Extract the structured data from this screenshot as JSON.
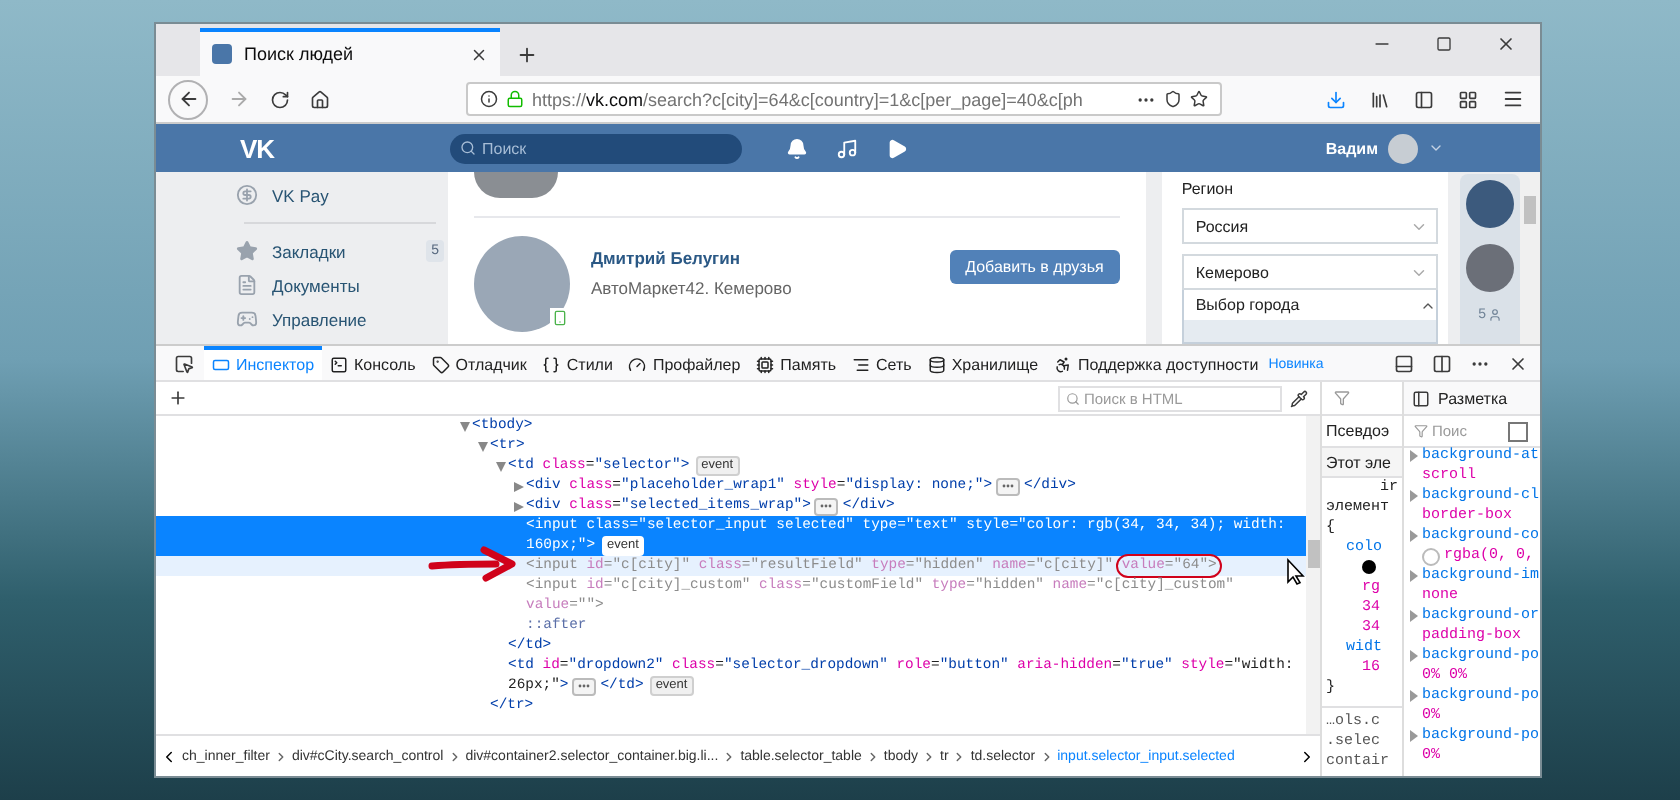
{
  "browser": {
    "tab": {
      "title": "Поиск людей"
    },
    "url": {
      "scheme": "https://",
      "host": "vk.com",
      "rest": "/search?c[city]=64&c[country]=1&c[per_page]=40&c[ph"
    }
  },
  "vk": {
    "logo": "VK",
    "search_placeholder": "Поиск",
    "user_name": "Вадим",
    "sidebar": [
      {
        "label": "VK Pay",
        "kind": "pay"
      },
      {
        "label": "Закладки",
        "kind": "star",
        "count": "5"
      },
      {
        "label": "Документы",
        "kind": "doc"
      },
      {
        "label": "Управление",
        "kind": "game"
      }
    ],
    "person": {
      "name": "Дмитрий Белугин",
      "subtitle": "АвтоМаркет42. Кемерово",
      "action": "Добавить в друзья",
      "online_mobile": true
    },
    "filters": {
      "title": "Регион",
      "country": "Россия",
      "city": "Кемерово",
      "options": [
        "Выбор города"
      ]
    },
    "friends_count": "5"
  },
  "devtools": {
    "tabs": [
      {
        "label": "Инспектор",
        "kind": "inspector",
        "selected": true
      },
      {
        "label": "Консоль",
        "kind": "console",
        "selected": false
      },
      {
        "label": "Отладчик",
        "kind": "debugger",
        "selected": false
      },
      {
        "label": "Стили",
        "kind": "styles",
        "selected": false
      },
      {
        "label": "Профайлер",
        "kind": "profiler",
        "selected": false
      },
      {
        "label": "Память",
        "kind": "memory",
        "selected": false
      },
      {
        "label": "Сеть",
        "kind": "network",
        "selected": false
      },
      {
        "label": "Хранилище",
        "kind": "storage",
        "selected": false
      },
      {
        "label": "Поддержка доступности",
        "kind": "accessibility",
        "selected": false,
        "badge": "Новинка"
      }
    ],
    "search_placeholder": "Поиск в HTML",
    "layout_tab": "Разметка",
    "markup": [
      {
        "parts": [
          {
            "kind": "code",
            "text": "<tbody>"
          }
        ],
        "expanded": true,
        "selected": false,
        "hovered": false,
        "dimmed": false,
        "children": [
          {
            "parts": [
              {
                "kind": "code",
                "text": "<tr>"
              }
            ],
            "expanded": true,
            "selected": false,
            "hovered": false,
            "dimmed": false,
            "children": [
              {
                "parts": [
                  {
                    "kind": "code",
                    "text": "<td class=\"selector\">"
                  },
                  {
                    "kind": "badge",
                    "text": "event"
                  }
                ],
                "expanded": true,
                "selected": false,
                "hovered": false,
                "dimmed": false,
                "children": [
                  {
                    "parts": [
                      {
                        "kind": "code",
                        "text": "<div class=\"placeholder_wrap1\" style=\"display: none;\">"
                      },
                      {
                        "kind": "ellipsis"
                      },
                      {
                        "kind": "code",
                        "text": "</div>"
                      }
                    ],
                    "expanded": false,
                    "selected": false,
                    "hovered": false,
                    "dimmed": false
                  },
                  {
                    "parts": [
                      {
                        "kind": "code",
                        "text": "<div class=\"selected_items_wrap\">"
                      },
                      {
                        "kind": "ellipsis"
                      },
                      {
                        "kind": "code",
                        "text": "</div>"
                      }
                    ],
                    "expanded": false,
                    "selected": false,
                    "hovered": false,
                    "dimmed": false
                  },
                  {
                    "parts": [
                      {
                        "kind": "code",
                        "text": "<input class=\"selector_input selected\" type=\"text\" style=\"color: rgb(34, 34, 34); width:"
                      },
                      {
                        "kind": "code",
                        "text": "160px;\">"
                      },
                      {
                        "kind": "badge",
                        "text": "event"
                      }
                    ],
                    "selected": true,
                    "hovered": false,
                    "dimmed": false
                  },
                  {
                    "parts": [
                      {
                        "kind": "code",
                        "text": "<input id=\"c[city]\" class=\"resultField\" type=\"hidden\" name=\"c[city]\" "
                      },
                      {
                        "kind": "circled",
                        "text": "value=\"64\">"
                      }
                    ],
                    "selected": false,
                    "hovered": true,
                    "dimmed": true
                  },
                  {
                    "parts": [
                      {
                        "kind": "code",
                        "text": "<input id=\"c[city]_custom\" class=\"customField\" type=\"hidden\" name=\"c[city]_custom\""
                      },
                      {
                        "kind": "code",
                        "text": "value=\"\">"
                      }
                    ],
                    "selected": false,
                    "hovered": false,
                    "dimmed": true
                  },
                  {
                    "parts": [
                      {
                        "kind": "code",
                        "text": "::after"
                      }
                    ],
                    "selected": false,
                    "hovered": false,
                    "dimmed": false
                  }
                ]
              },
              {
                "parts": [
                  {
                    "kind": "code",
                    "text": "</td>"
                  }
                ],
                "selected": false,
                "hovered": false,
                "dimmed": false
              },
              {
                "parts": [
                  {
                    "kind": "code",
                    "text": "<td id=\"dropdown2\" class=\"selector_dropdown\" role=\"button\" aria-hidden=\"true\" style=\"width:"
                  },
                  {
                    "kind": "code",
                    "text": "26px;\">"
                  },
                  {
                    "kind": "ellipsis"
                  },
                  {
                    "kind": "code",
                    "text": "</td>"
                  },
                  {
                    "kind": "badge",
                    "text": "event"
                  }
                ],
                "selected": false,
                "hovered": false,
                "dimmed": false
              }
            ]
          },
          {
            "parts": [
              {
                "kind": "code",
                "text": "</tr>"
              }
            ],
            "selected": false,
            "hovered": false,
            "dimmed": false
          }
        ]
      }
    ],
    "breadcrumbs": [
      {
        "text": "ch_inner_filter",
        "selected": false
      },
      {
        "text": "div#cCity.search_control",
        "selected": false
      },
      {
        "text": "div#container2.selector_container.big.li...",
        "selected": false
      },
      {
        "text": "table.selector_table",
        "selected": false
      },
      {
        "text": "tbody",
        "selected": false
      },
      {
        "text": "tr",
        "selected": false
      },
      {
        "text": "td.selector",
        "selected": false
      },
      {
        "text": "input.selector_input.selected",
        "selected": true
      }
    ],
    "rules": {
      "header": "Псевдоэ",
      "section": "Этот эле",
      "lines": [
        {
          "kind": "origin",
          "text": "ir"
        },
        {
          "kind": "selector",
          "text": "элемент"
        },
        {
          "kind": "brace",
          "text": "{"
        },
        {
          "kind": "prop",
          "text": "colo"
        },
        {
          "kind": "swatch"
        },
        {
          "kind": "value",
          "text": "rg"
        },
        {
          "kind": "value",
          "text": "34"
        },
        {
          "kind": "value",
          "text": "34"
        },
        {
          "kind": "prop",
          "text": "widt"
        },
        {
          "kind": "value",
          "text": "16"
        },
        {
          "kind": "brace",
          "text": "}"
        }
      ],
      "sources": [
        "…ols.c",
        ".selec",
        "contair"
      ]
    },
    "computed": {
      "filter_placeholder": "Поис",
      "browser_styles": false,
      "properties": [
        {
          "name": "background-at",
          "value": "scroll",
          "swatch": false
        },
        {
          "name": "background-cl",
          "value": "border-box",
          "swatch": false
        },
        {
          "name": "background-co",
          "value": "rgba(0, 0,",
          "swatch": true
        },
        {
          "name": "background-im",
          "value": "none",
          "swatch": false
        },
        {
          "name": "background-or",
          "value": "padding-box",
          "swatch": false
        },
        {
          "name": "background-po",
          "value": "0% 0%",
          "swatch": false
        },
        {
          "name": "background-po",
          "value": "0%",
          "swatch": false
        },
        {
          "name": "background-po",
          "value": "0%",
          "swatch": false
        }
      ]
    }
  }
}
